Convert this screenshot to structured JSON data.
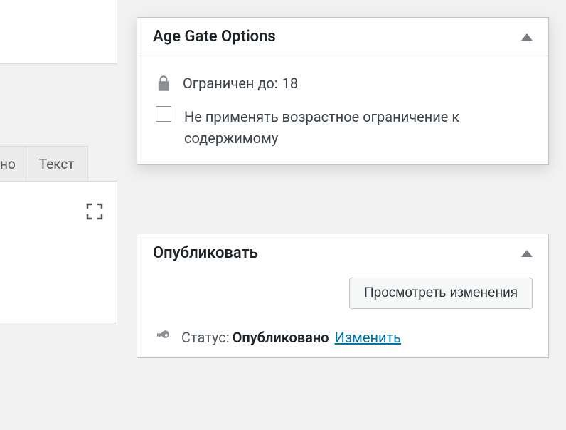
{
  "editor": {
    "tabs": {
      "visual_partial": "но",
      "text": "Текст"
    }
  },
  "age_gate": {
    "title": "Age Gate Options",
    "restricted_label": "Ограничен до:",
    "restricted_value": "18",
    "bypass_label": "Не применять возрастное ограничение к содержимому"
  },
  "publish": {
    "title": "Опубликовать",
    "preview_button": "Просмотреть изменения",
    "status_label": "Статус:",
    "status_value": "Опубликовано",
    "edit_link": "Изменить"
  }
}
